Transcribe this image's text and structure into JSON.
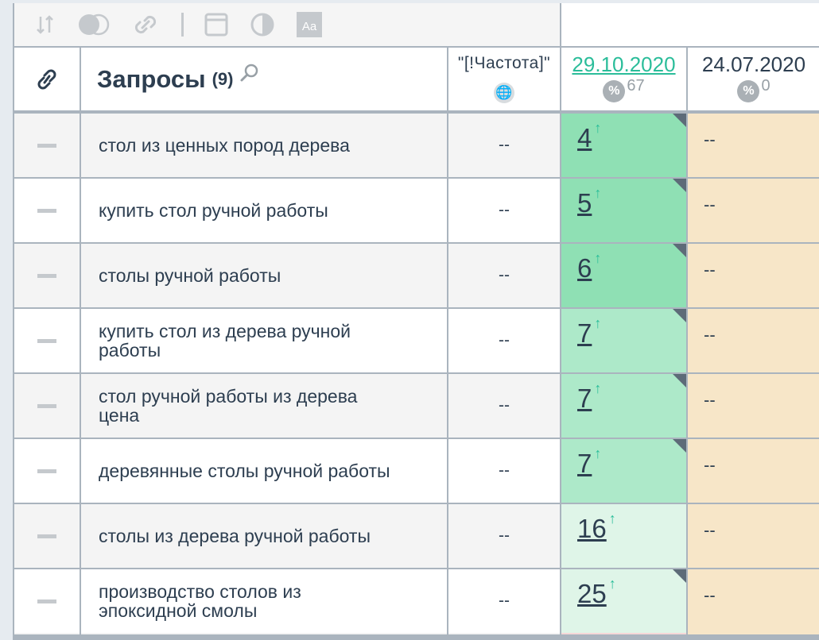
{
  "toolbar": {
    "icons": [
      "sort-icon",
      "toggle-icon",
      "link-icon",
      "window-icon",
      "contrast-icon",
      "font-icon"
    ]
  },
  "header": {
    "queries_title": "Запросы",
    "queries_count": "(9)",
    "frequency_label": "\"[!Частота]\"",
    "date1": "29.10.2020",
    "date1_percent": "67",
    "date2": "24.07.2020",
    "date2_percent": "0",
    "pct_symbol": "%"
  },
  "rows": [
    {
      "query": "стол из ценных пород дерева",
      "frequency": "--",
      "position": "4",
      "old": "--"
    },
    {
      "query": "купить стол ручной работы",
      "frequency": "--",
      "position": "5",
      "old": "--"
    },
    {
      "query": "столы ручной работы",
      "frequency": "--",
      "position": "6",
      "old": "--"
    },
    {
      "query": "купить стол из дерева ручной работы",
      "frequency": "--",
      "position": "7",
      "old": "--"
    },
    {
      "query": "стол ручной работы из дерева цена",
      "frequency": "--",
      "position": "7",
      "old": "--"
    },
    {
      "query": "деревянные столы ручной работы",
      "frequency": "--",
      "position": "7",
      "old": "--"
    },
    {
      "query": "столы из дерева ручной работы",
      "frequency": "--",
      "position": "16",
      "old": "--"
    },
    {
      "query": "производство столов из эпоксидной смолы",
      "frequency": "--",
      "position": "25",
      "old": "--"
    }
  ],
  "colors": {
    "accent": "#2bbd9a",
    "old_cell": "#f7e6c8",
    "pos_top": "#8fe0b4",
    "pos_mid": "#ade9c9",
    "pos_low": "#dff5e8",
    "pos_bottom": "#f6d8d8"
  }
}
